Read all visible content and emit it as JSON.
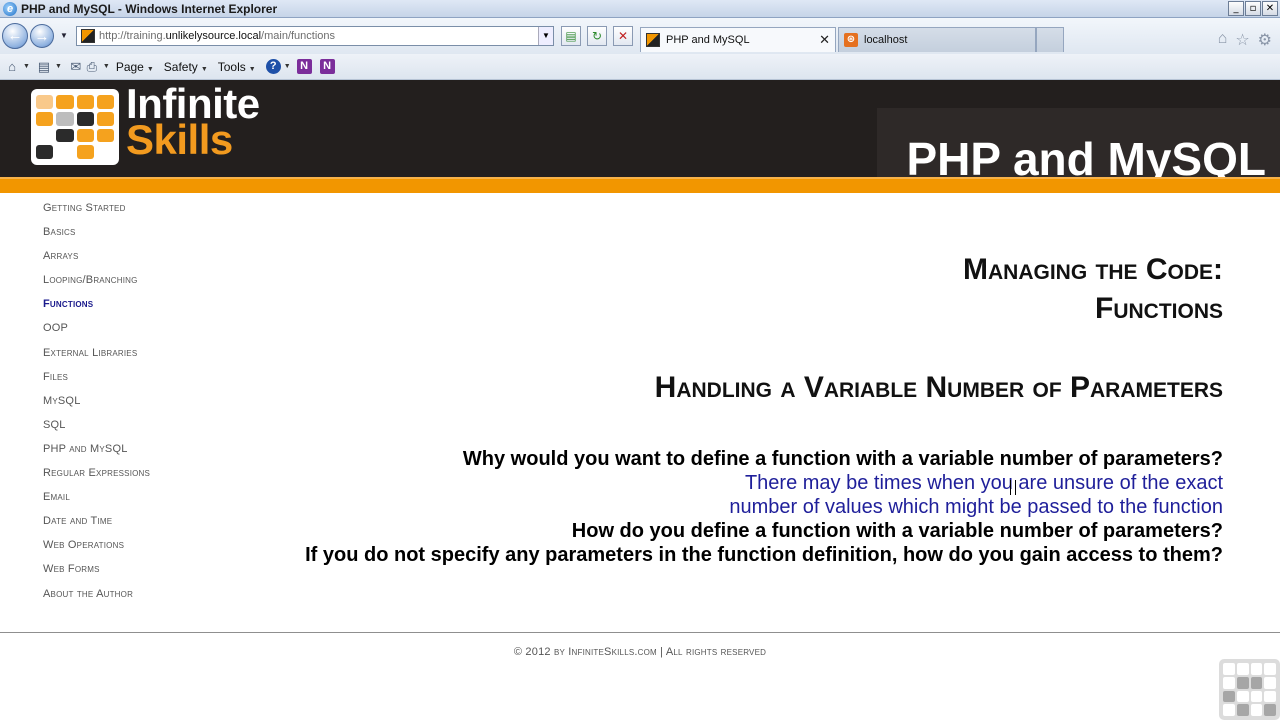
{
  "window": {
    "title": "PHP and MySQL - Windows Internet Explorer",
    "buttons": {
      "minimize": "_",
      "restore": "▫",
      "close": "✕"
    }
  },
  "browser": {
    "address_prefix": "http://training.",
    "address_domain": "unlikelysource.local",
    "address_path": "/main/functions",
    "tabs": [
      {
        "label": "PHP and MySQL",
        "active": true,
        "close": "✕"
      },
      {
        "label": "localhost",
        "active": false
      }
    ],
    "command_bar": {
      "page": "Page",
      "safety": "Safety",
      "tools": "Tools",
      "help": "?",
      "onenote_1": "N",
      "onenote_2": "N"
    }
  },
  "header": {
    "logo_line1": "Infinite",
    "logo_line2": "Skills",
    "course_title": "PHP and MySQL",
    "colors": {
      "accent": "#f29600",
      "dark": "#231f1e"
    }
  },
  "sidebar": {
    "items": [
      {
        "label": "Getting Started"
      },
      {
        "label": "Basics"
      },
      {
        "label": "Arrays"
      },
      {
        "label": "Looping/Branching"
      },
      {
        "label": "Functions",
        "active": true
      },
      {
        "label": "OOP"
      },
      {
        "label": "External Libraries"
      },
      {
        "label": "Files"
      },
      {
        "label": "MySQL"
      },
      {
        "label": "SQL"
      },
      {
        "label": "PHP and MySQL"
      },
      {
        "label": "Regular Expressions"
      },
      {
        "label": "Email"
      },
      {
        "label": "Date and Time"
      },
      {
        "label": "Web Operations"
      },
      {
        "label": "Web Forms"
      },
      {
        "label": "About the Author"
      }
    ]
  },
  "main": {
    "heading_line1": "Managing the Code:",
    "heading_line2": "Functions",
    "subheading": "Handling a Variable Number of Parameters",
    "lines": [
      {
        "kind": "q",
        "text": "Why would you want to define a function with a variable number of parameters?"
      },
      {
        "kind": "a",
        "text": "There may be times when you are unsure of the exact"
      },
      {
        "kind": "a",
        "text": "number of values which might be passed to the function"
      },
      {
        "kind": "q",
        "text": "How do you define a function with a variable number of parameters?"
      },
      {
        "kind": "q",
        "text": "If you do not specify any parameters in the function definition, how do you gain access to them?"
      }
    ]
  },
  "footer": {
    "text": "© 2012 by InfiniteSkills.com | All rights reserved"
  }
}
